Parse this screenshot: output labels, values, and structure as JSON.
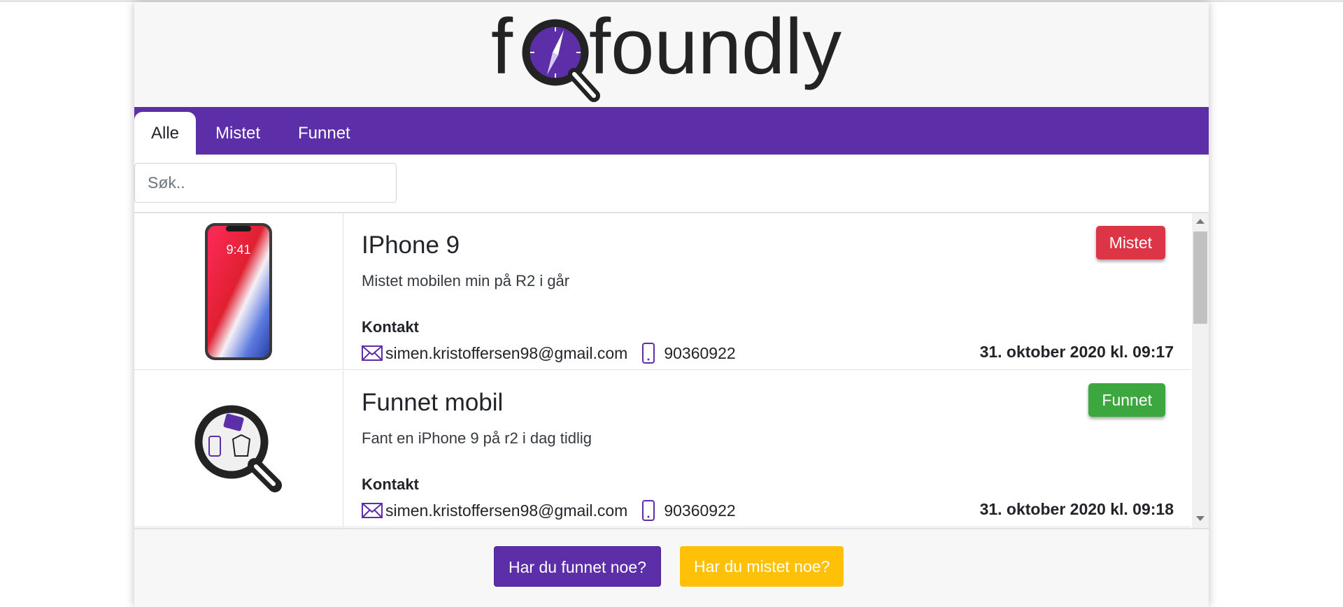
{
  "app": {
    "logo_text": "foundly"
  },
  "nav": {
    "tabs": [
      {
        "label": "Alle",
        "active": true
      },
      {
        "label": "Mistet",
        "active": false
      },
      {
        "label": "Funnet",
        "active": false
      }
    ]
  },
  "search": {
    "placeholder": "Søk..",
    "value": ""
  },
  "items": [
    {
      "title": "IPhone 9",
      "description": "Mistet mobilen min på R2 i går",
      "contact_label": "Kontakt",
      "email": "simen.kristoffersen98@gmail.com",
      "phone": "90360922",
      "date": "31. oktober 2020 kl. 09:17",
      "status": "Mistet",
      "status_color": "#dc3545",
      "image": "iphone-image"
    },
    {
      "title": "Funnet mobil",
      "description": "Fant en iPhone 9 på r2 i dag tidlig",
      "contact_label": "Kontakt",
      "email": "simen.kristoffersen98@gmail.com",
      "phone": "90360922",
      "date": "31. oktober 2020 kl. 09:18",
      "status": "Funnet",
      "status_color": "#3da73f",
      "image": "magnifier-placeholder-image"
    }
  ],
  "footer": {
    "found_button": "Har du funnet noe?",
    "lost_button": "Har du mistet noe?"
  },
  "colors": {
    "brand_purple": "#5c2fa8",
    "lost_red": "#dc3545",
    "found_green": "#3da73f",
    "lost_yellow": "#ffc107"
  }
}
